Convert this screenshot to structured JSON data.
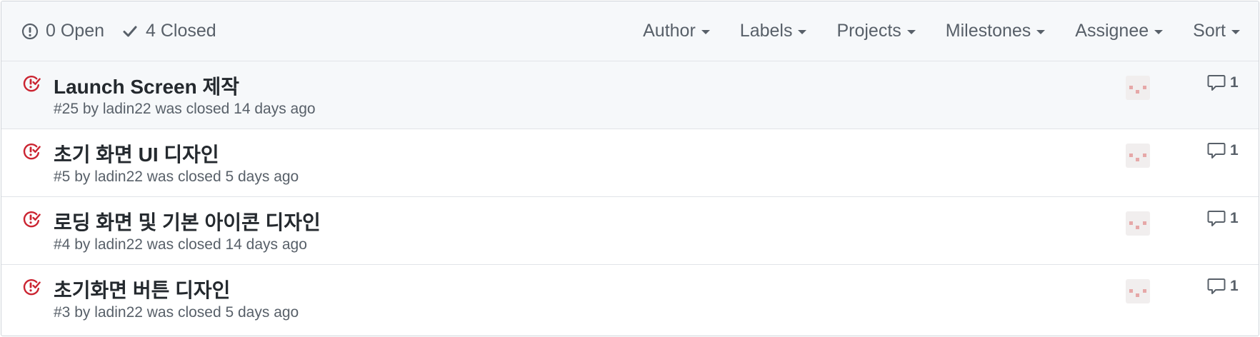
{
  "header": {
    "open_label": "0 Open",
    "closed_label": "4 Closed",
    "filters": [
      "Author",
      "Labels",
      "Projects",
      "Milestones",
      "Assignee",
      "Sort"
    ]
  },
  "issues": [
    {
      "title": "Launch Screen 제작",
      "meta": "#25 by ladin22 was closed 14 days ago",
      "comments": "1"
    },
    {
      "title": "초기 화면 UI 디자인",
      "meta": "#5 by ladin22 was closed 5 days ago",
      "comments": "1"
    },
    {
      "title": "로딩 화면 및 기본 아이콘 디자인",
      "meta": "#4 by ladin22 was closed 14 days ago",
      "comments": "1"
    },
    {
      "title": "초기화면 버튼 디자인",
      "meta": "#3 by ladin22 was closed 5 days ago",
      "comments": "1"
    }
  ],
  "colors": {
    "closed_issue_icon": "#cb2431",
    "muted_text": "#586069",
    "header_bg": "#f6f8fa"
  },
  "icons": {
    "open_state": "issue-opened-icon",
    "closed_state": "check-icon",
    "issue_row": "issue-closed-icon",
    "comments": "comment-icon"
  }
}
